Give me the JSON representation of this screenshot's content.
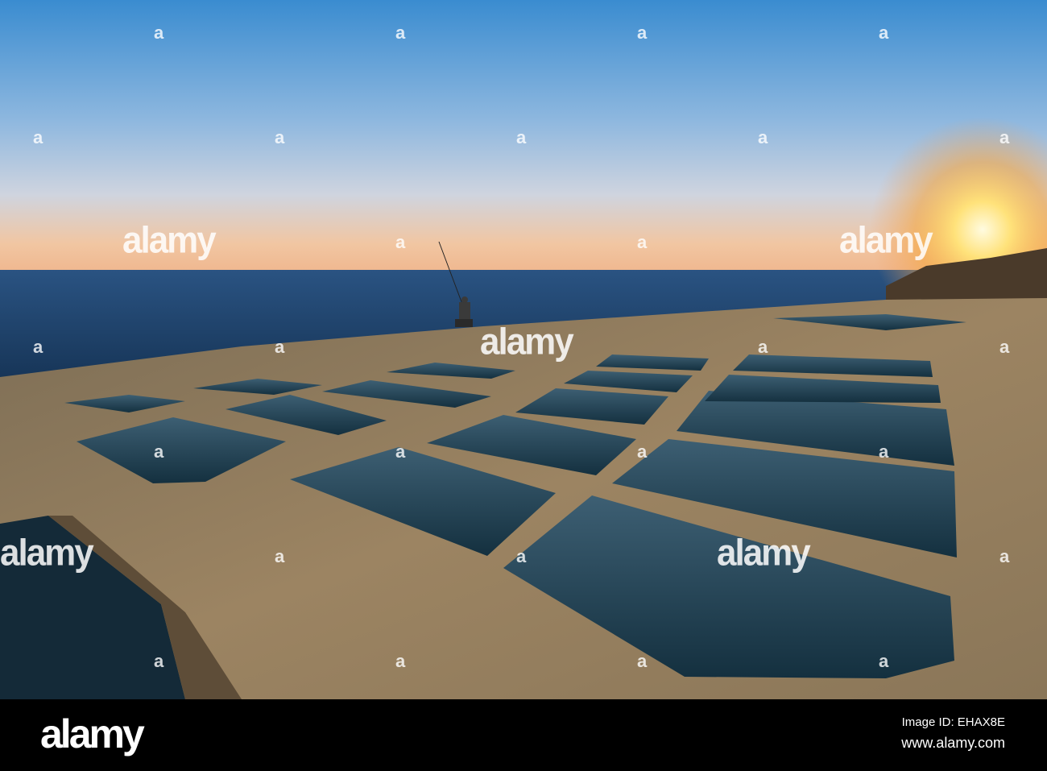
{
  "photo": {
    "subject": "salt-pans-at-sunset",
    "colors": {
      "sky_top": "#3a8cd0",
      "sky_mid": "#b7cfe6",
      "sky_horizon": "#f3c59a",
      "sun": "#fff6c0",
      "sea": "#1b3c64",
      "stone": "#8f7a55",
      "pool": "#1e3a4a"
    }
  },
  "watermark": {
    "text": "alamy",
    "mark": "a"
  },
  "footer": {
    "logo": "alamy",
    "image_id": "Image ID: EHAX8E",
    "url": "www.alamy.com"
  }
}
